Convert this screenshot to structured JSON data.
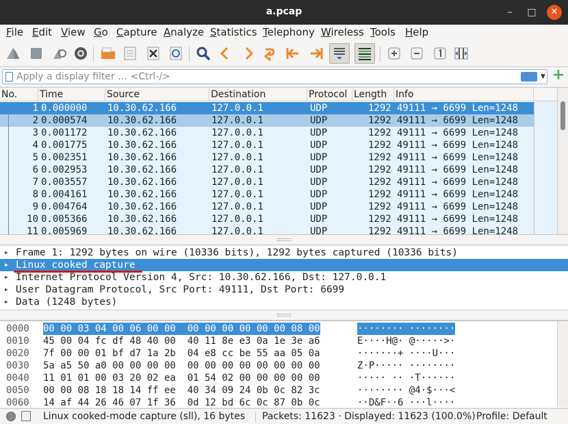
{
  "window": {
    "title": "a.pcap",
    "minimize": "–",
    "maximize": "□",
    "close": "✕"
  },
  "menu": [
    "File",
    "Edit",
    "View",
    "Go",
    "Capture",
    "Analyze",
    "Statistics",
    "Telephony",
    "Wireless",
    "Tools",
    "Help"
  ],
  "toolbar": {
    "icons": [
      "shark-fin-start-icon",
      "stop-icon",
      "restart-capture-icon",
      "capture-options-icon",
      "open-file-icon",
      "save-file-icon",
      "close-file-icon",
      "reload-file-icon",
      "find-icon",
      "go-back-icon",
      "go-forward-icon",
      "go-to-packet-icon",
      "first-packet-icon",
      "last-packet-icon",
      "autoscroll-icon",
      "colorize-icon",
      "zoom-in-icon",
      "zoom-out-icon",
      "normal-size-icon",
      "resize-columns-icon"
    ]
  },
  "filter": {
    "placeholder": "Apply a display filter … <Ctrl-/>",
    "value": ""
  },
  "packet_list": {
    "columns": [
      "No.",
      "Time",
      "Source",
      "Destination",
      "Protocol",
      "Length",
      "Info"
    ],
    "rows": [
      {
        "no": "1",
        "time": "0.000000",
        "src": "10.30.62.166",
        "dst": "127.0.0.1",
        "proto": "UDP",
        "len": "1292",
        "info": "49111 → 6699 Len=1248"
      },
      {
        "no": "2",
        "time": "0.000574",
        "src": "10.30.62.166",
        "dst": "127.0.0.1",
        "proto": "UDP",
        "len": "1292",
        "info": "49111 → 6699 Len=1248"
      },
      {
        "no": "3",
        "time": "0.001172",
        "src": "10.30.62.166",
        "dst": "127.0.0.1",
        "proto": "UDP",
        "len": "1292",
        "info": "49111 → 6699 Len=1248"
      },
      {
        "no": "4",
        "time": "0.001775",
        "src": "10.30.62.166",
        "dst": "127.0.0.1",
        "proto": "UDP",
        "len": "1292",
        "info": "49111 → 6699 Len=1248"
      },
      {
        "no": "5",
        "time": "0.002351",
        "src": "10.30.62.166",
        "dst": "127.0.0.1",
        "proto": "UDP",
        "len": "1292",
        "info": "49111 → 6699 Len=1248"
      },
      {
        "no": "6",
        "time": "0.002953",
        "src": "10.30.62.166",
        "dst": "127.0.0.1",
        "proto": "UDP",
        "len": "1292",
        "info": "49111 → 6699 Len=1248"
      },
      {
        "no": "7",
        "time": "0.003557",
        "src": "10.30.62.166",
        "dst": "127.0.0.1",
        "proto": "UDP",
        "len": "1292",
        "info": "49111 → 6699 Len=1248"
      },
      {
        "no": "8",
        "time": "0.004161",
        "src": "10.30.62.166",
        "dst": "127.0.0.1",
        "proto": "UDP",
        "len": "1292",
        "info": "49111 → 6699 Len=1248"
      },
      {
        "no": "9",
        "time": "0.004764",
        "src": "10.30.62.166",
        "dst": "127.0.0.1",
        "proto": "UDP",
        "len": "1292",
        "info": "49111 → 6699 Len=1248"
      },
      {
        "no": "10",
        "time": "0.005366",
        "src": "10.30.62.166",
        "dst": "127.0.0.1",
        "proto": "UDP",
        "len": "1292",
        "info": "49111 → 6699 Len=1248"
      },
      {
        "no": "11",
        "time": "0.005969",
        "src": "10.30.62.166",
        "dst": "127.0.0.1",
        "proto": "UDP",
        "len": "1292",
        "info": "49111 → 6699 Len=1248"
      }
    ]
  },
  "details": [
    "Frame 1: 1292 bytes on wire (10336 bits), 1292 bytes captured (10336 bits)",
    "Linux cooked capture",
    "Internet Protocol Version 4, Src: 10.30.62.166, Dst: 127.0.0.1",
    "User Datagram Protocol, Src Port: 49111, Dst Port: 6699",
    "Data (1248 bytes)"
  ],
  "hex": [
    {
      "off": "0000",
      "bytes": "00 00 03 04 00 06 00 00  00 00 00 00 00 00 08 00",
      "ascii": "········ ········"
    },
    {
      "off": "0010",
      "bytes": "45 00 04 fc df 48 40 00  40 11 8e e3 0a 1e 3e a6",
      "ascii": "E····H@· @·····>·"
    },
    {
      "off": "0020",
      "bytes": "7f 00 00 01 bf d7 1a 2b  04 e8 cc be 55 aa 05 0a",
      "ascii": "·······+ ····U···"
    },
    {
      "off": "0030",
      "bytes": "5a a5 50 a0 00 00 00 00  00 00 00 00 00 00 00 00",
      "ascii": "Z·P····· ········"
    },
    {
      "off": "0040",
      "bytes": "11 01 01 00 03 20 02 ea  01 54 02 00 00 00 00 00",
      "ascii": "····· ·· ·T······"
    },
    {
      "off": "0050",
      "bytes": "00 00 08 18 18 14 ff ee  40 34 09 24 0b 0c 82 3c",
      "ascii": "········ @4·$···<"
    },
    {
      "off": "0060",
      "bytes": "14 af 44 26 46 07 1f 36  0d 12 bd 6c 0c 87 0b 0c",
      "ascii": "··D&F··6 ···l····"
    }
  ],
  "status": {
    "selection": "Linux cooked-mode capture (sll), 16 bytes",
    "packets": "Packets: 11623 · Displayed: 11623 (100.0%)",
    "profile": "Profile: Default"
  }
}
